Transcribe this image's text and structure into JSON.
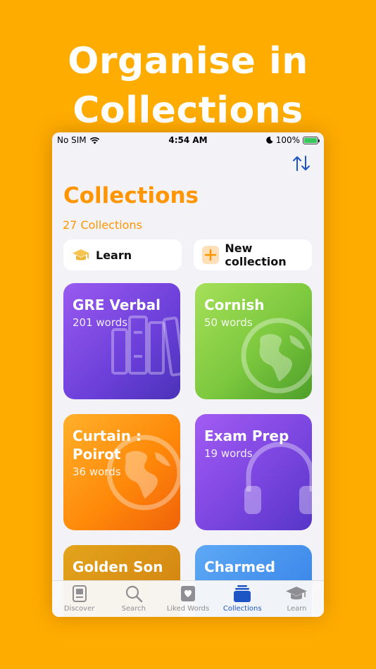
{
  "headline": {
    "line1": "Organise in",
    "line2": "Collections"
  },
  "status": {
    "carrier": "No SIM",
    "time": "4:54 AM",
    "battery": "100%"
  },
  "page": {
    "title": "Collections",
    "count": "27 Collections"
  },
  "actions": {
    "learn": "Learn",
    "new_collection": "New collection"
  },
  "cards": [
    {
      "title": "GRE Verbal",
      "words": "201 words",
      "icon": "books-icon"
    },
    {
      "title": "Cornish",
      "words": "50 words",
      "icon": "globe-icon"
    },
    {
      "title": "Curtain : Poirot",
      "words": "36 words",
      "icon": "globe-icon"
    },
    {
      "title": "Exam Prep",
      "words": "19 words",
      "icon": "headphones-icon"
    },
    {
      "title": "Golden Son",
      "words": "",
      "icon": ""
    },
    {
      "title": "Charmed",
      "words": "",
      "icon": ""
    }
  ],
  "tabs": [
    {
      "label": "Discover",
      "icon": "book-icon"
    },
    {
      "label": "Search",
      "icon": "search-icon"
    },
    {
      "label": "Liked Words",
      "icon": "heart-icon"
    },
    {
      "label": "Collections",
      "icon": "stack-icon"
    },
    {
      "label": "Learn",
      "icon": "graduation-cap-icon"
    }
  ],
  "colors": {
    "background": "#FFAC00",
    "accent": "#FF9500",
    "tab_active": "#1E55C5"
  }
}
